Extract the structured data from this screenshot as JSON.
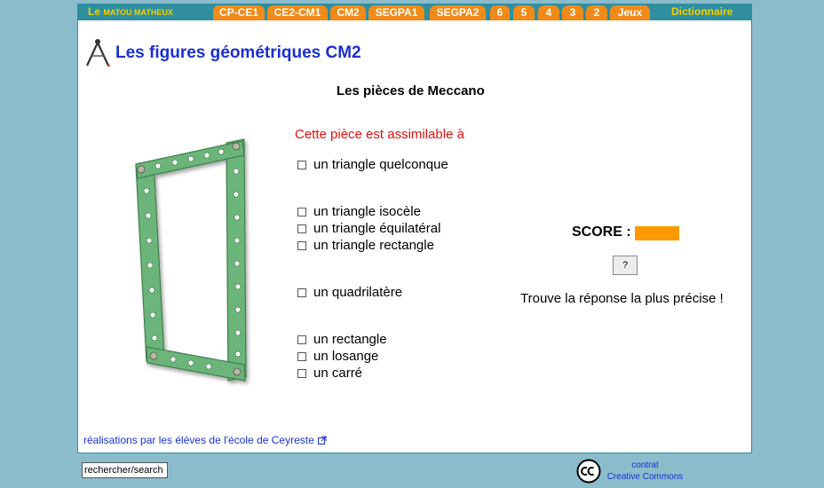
{
  "nav": {
    "brand_prefix": "Le",
    "brand_rest": "Matou matheux",
    "tabs": [
      "CP-CE1",
      "CE2-CM1",
      "CM2",
      "SEGPA1",
      "SEGPA2",
      "6",
      "5",
      "4",
      "3",
      "2",
      "Jeux"
    ],
    "dictionary": "Dictionnaire"
  },
  "page": {
    "title": "Les figures géométriques CM2",
    "subtitle": "Les pièces de Meccano",
    "prompt": "Cette pièce est assimilable à"
  },
  "options": [
    "un triangle quelconque",
    "un triangle isocèle",
    "un triangle équilatéral",
    "un triangle rectangle",
    "un quadrilatère",
    "un rectangle",
    "un losange",
    "un carré"
  ],
  "score": {
    "label": "SCORE :",
    "value": ""
  },
  "help_button": "?",
  "hint": "Trouve la réponse la plus précise !",
  "footer": {
    "credit": "réalisations par les élèves de l'école de Ceyreste",
    "search_value": "rechercher/search",
    "cc_line1": "contrat",
    "cc_line2": "Creative Commons"
  },
  "colors": {
    "nav_bar": "#2f8f9f",
    "tab": "#f08a18",
    "brand": "#f4d000",
    "title": "#1a2fd0",
    "prompt": "#e01010",
    "score_box": "#ff9900",
    "piece": "#6cb57a"
  }
}
